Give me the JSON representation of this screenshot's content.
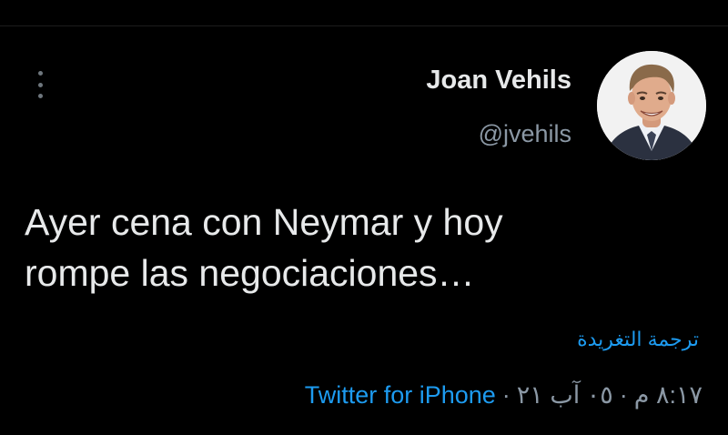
{
  "tweet": {
    "author": {
      "display_name": "Joan Vehils",
      "handle": "@jvehils"
    },
    "text_line1": "Ayer cena con Neymar y hoy",
    "text_line2": "rompe las negociaciones…",
    "translate_label": "ترجمة التغريدة",
    "meta": {
      "time": "٨:١٧ م",
      "separator": "·",
      "date": "٠٥ آب ٢١",
      "source": "Twitter for iPhone"
    }
  },
  "icons": {
    "more": "vertical-ellipsis-icon"
  },
  "colors": {
    "background": "#000000",
    "text": "#e7e9ea",
    "secondary": "#8b98a5",
    "link": "#1d9bf0"
  }
}
